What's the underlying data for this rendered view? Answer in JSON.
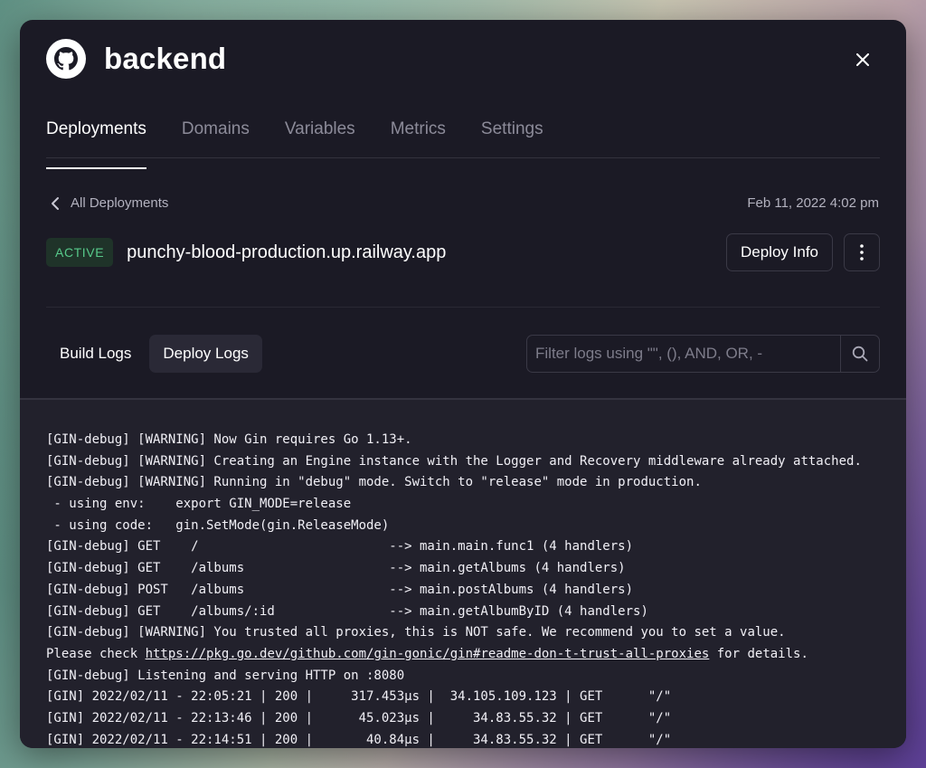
{
  "service": {
    "title": "backend",
    "icon": "github-icon"
  },
  "tabs": [
    {
      "label": "Deployments",
      "active": true
    },
    {
      "label": "Domains",
      "active": false
    },
    {
      "label": "Variables",
      "active": false
    },
    {
      "label": "Metrics",
      "active": false
    },
    {
      "label": "Settings",
      "active": false
    }
  ],
  "breadcrumb": {
    "label": "All Deployments",
    "date": "Feb 11, 2022 4:02 pm"
  },
  "deployment": {
    "status": "ACTIVE",
    "url": "punchy-blood-production.up.railway.app",
    "deploy_info_label": "Deploy Info"
  },
  "logs": {
    "tabs": [
      {
        "label": "Build Logs",
        "active": false
      },
      {
        "label": "Deploy Logs",
        "active": true
      }
    ],
    "filter_placeholder": "Filter logs using \"\", (), AND, OR, -",
    "lines": [
      "[GIN-debug] [WARNING] Now Gin requires Go 1.13+.",
      "[GIN-debug] [WARNING] Creating an Engine instance with the Logger and Recovery middleware already attached.",
      "[GIN-debug] [WARNING] Running in \"debug\" mode. Switch to \"release\" mode in production.",
      " - using env:    export GIN_MODE=release",
      " - using code:   gin.SetMode(gin.ReleaseMode)",
      "[GIN-debug] GET    /                         --> main.main.func1 (4 handlers)",
      "[GIN-debug] GET    /albums                   --> main.getAlbums (4 handlers)",
      "[GIN-debug] POST   /albums                   --> main.postAlbums (4 handlers)",
      "[GIN-debug] GET    /albums/:id               --> main.getAlbumByID (4 handlers)",
      "[GIN-debug] [WARNING] You trusted all proxies, this is NOT safe. We recommend you to set a value.",
      {
        "before": "Please check ",
        "link": "https://pkg.go.dev/github.com/gin-gonic/gin#readme-don-t-trust-all-proxies",
        "after": " for details."
      },
      "[GIN-debug] Listening and serving HTTP on :8080",
      "[GIN] 2022/02/11 - 22:05:21 | 200 |     317.453µs |  34.105.109.123 | GET      \"/\"",
      "[GIN] 2022/02/11 - 22:13:46 | 200 |      45.023µs |     34.83.55.32 | GET      \"/\"",
      "[GIN] 2022/02/11 - 22:14:51 | 200 |       40.84µs |     34.83.55.32 | GET      \"/\""
    ]
  }
}
